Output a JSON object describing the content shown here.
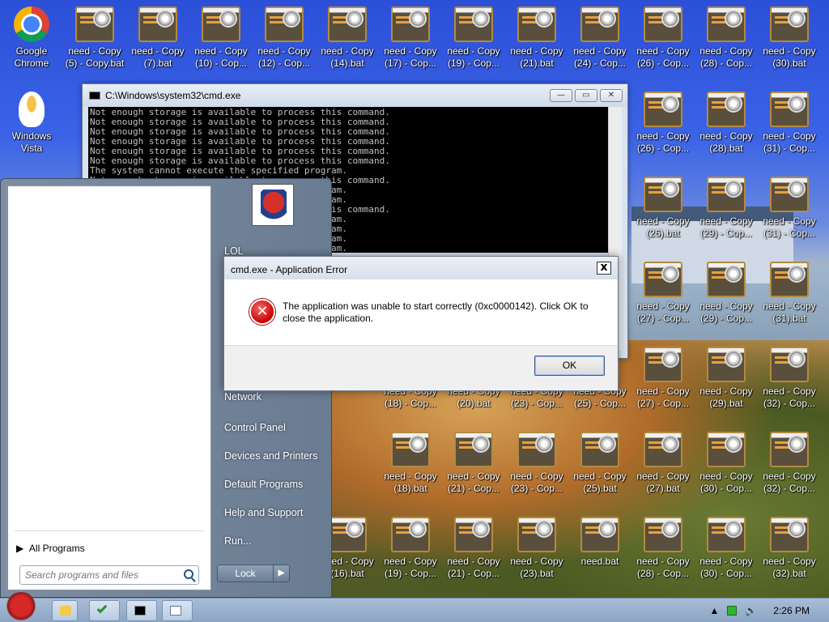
{
  "desktop": {
    "icons": [
      {
        "label": "Google\nChrome",
        "type": "chrome"
      },
      {
        "label": "need - Copy\n(5) - Copy.bat",
        "type": "bat"
      },
      {
        "label": "need - Copy\n(7).bat",
        "type": "bat"
      },
      {
        "label": "need - Copy\n(10) - Cop...",
        "type": "bat"
      },
      {
        "label": "need - Copy\n(12) - Cop...",
        "type": "bat"
      },
      {
        "label": "need - Copy\n(14).bat",
        "type": "bat"
      },
      {
        "label": "need - Copy\n(17) - Cop...",
        "type": "bat"
      },
      {
        "label": "need - Copy\n(19) - Cop...",
        "type": "bat"
      },
      {
        "label": "need - Copy\n(21).bat",
        "type": "bat"
      },
      {
        "label": "need - Copy\n(24) - Cop...",
        "type": "bat"
      },
      {
        "label": "need - Copy\n(26) - Cop...",
        "type": "bat"
      },
      {
        "label": "need - Copy\n(28) - Cop...",
        "type": "bat"
      },
      {
        "label": "need - Copy\n(30).bat",
        "type": "bat"
      },
      {
        "label": "Windows\nVista",
        "type": "egg"
      },
      {
        "label": "need - Copy\n(26) - Cop...",
        "type": "bat"
      },
      {
        "label": "need - Copy\n(28).bat",
        "type": "bat"
      },
      {
        "label": "need - Copy\n(31) - Cop...",
        "type": "bat"
      },
      {
        "label": "need - Copy\n(26).bat",
        "type": "bat"
      },
      {
        "label": "need - Copy\n(29) - Cop...",
        "type": "bat"
      },
      {
        "label": "need - Copy\n(31) - Cop...",
        "type": "bat"
      },
      {
        "label": "need - Copy\n(27) - Cop...",
        "type": "bat"
      },
      {
        "label": "need - Copy\n(29) - Cop...",
        "type": "bat"
      },
      {
        "label": "need - Copy\n(31).bat",
        "type": "bat"
      },
      {
        "label": "need - Copy\n(18) - Cop...",
        "type": "bat"
      },
      {
        "label": "need - Copy\n(20).bat",
        "type": "bat"
      },
      {
        "label": "need - Copy\n(23) - Cop...",
        "type": "bat"
      },
      {
        "label": "need - Copy\n(25) - Cop...",
        "type": "bat"
      },
      {
        "label": "need - Copy\n(27) - Cop...",
        "type": "bat"
      },
      {
        "label": "need - Copy\n(29).bat",
        "type": "bat"
      },
      {
        "label": "need - Copy\n(32) - Cop...",
        "type": "bat"
      },
      {
        "label": "need - Copy\n(18).bat",
        "type": "bat"
      },
      {
        "label": "need - Copy\n(21) - Cop...",
        "type": "bat"
      },
      {
        "label": "need - Copy\n(23) - Cop...",
        "type": "bat"
      },
      {
        "label": "need - Copy\n(25).bat",
        "type": "bat"
      },
      {
        "label": "need - Copy\n(27).bat",
        "type": "bat"
      },
      {
        "label": "need - Copy\n(30) - Cop...",
        "type": "bat"
      },
      {
        "label": "need - Copy\n(32) - Cop...",
        "type": "bat"
      },
      {
        "label": "need - Copy\n(19) - Cop...",
        "type": "bat"
      },
      {
        "label": "need - Copy\n(21) - Cop...",
        "type": "bat"
      },
      {
        "label": "need - Copy\n(23).bat",
        "type": "bat"
      },
      {
        "label": "need.bat",
        "type": "bat"
      },
      {
        "label": "need - Copy\n(28) - Cop...",
        "type": "bat"
      },
      {
        "label": "need - Copy\n(30) - Cop...",
        "type": "bat"
      },
      {
        "label": "need - Copy\n(32).bat",
        "type": "bat"
      },
      {
        "label": "need - Copy\n(16).bat",
        "type": "bat"
      }
    ]
  },
  "cmd": {
    "title": "C:\\Windows\\system32\\cmd.exe",
    "lines": [
      "Not enough storage is available to process this command.",
      "Not enough storage is available to process this command.",
      "Not enough storage is available to process this command.",
      "Not enough storage is available to process this command.",
      "Not enough storage is available to process this command.",
      "Not enough storage is available to process this command.",
      "The system cannot execute the specified program.",
      "Not enough storage is available to process this command.",
      "The system cannot execute the specified program.",
      "The system cannot execute the specified program.",
      "Not enough storage is available to process this command.",
      "The system cannot execute the specified program.",
      "The system cannot execute the specified program.",
      "The system cannot execute the specified program.",
      "The system cannot execute the specified program."
    ]
  },
  "startmenu": {
    "user": "LOL",
    "right_items": [
      "Network",
      "Control Panel",
      "Devices and Printers",
      "Default Programs",
      "Help and Support",
      "Run..."
    ],
    "all_programs": "All Programs",
    "search_placeholder": "Search programs and files",
    "lock_label": "Lock"
  },
  "dialog": {
    "title": "cmd.exe - Application Error",
    "message": "The application was unable to start correctly (0xc0000142). Click OK to close the application.",
    "ok_label": "OK",
    "close_label": "x"
  },
  "taskbar": {
    "clock": "2:26 PM"
  }
}
